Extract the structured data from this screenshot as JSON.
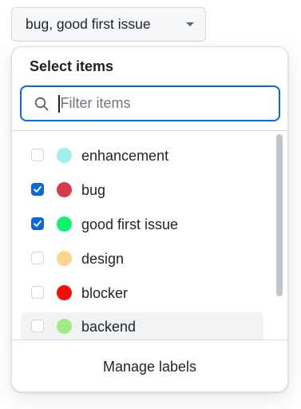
{
  "trigger": {
    "label": "bug, good first issue",
    "caret_icon": "triangle-down-icon"
  },
  "panel": {
    "title": "Select items",
    "filter": {
      "placeholder": "Filter items",
      "value": "",
      "icon": "search-icon"
    },
    "items": [
      {
        "label": "enhancement",
        "color": "#a2eeef",
        "checked": false,
        "hovered": false
      },
      {
        "label": "bug",
        "color": "#d73a4a",
        "checked": true,
        "hovered": false
      },
      {
        "label": "good first issue",
        "color": "#0ef36f",
        "checked": true,
        "hovered": false
      },
      {
        "label": "design",
        "color": "#fbd68c",
        "checked": false,
        "hovered": false
      },
      {
        "label": "blocker",
        "color": "#f70a0a",
        "checked": false,
        "hovered": false
      },
      {
        "label": "backend",
        "color": "#a5ea88",
        "checked": false,
        "hovered": true
      }
    ],
    "footer": {
      "manage_label": "Manage labels"
    }
  },
  "colors": {
    "accent": "#0969da",
    "border": "#d8dee4"
  }
}
